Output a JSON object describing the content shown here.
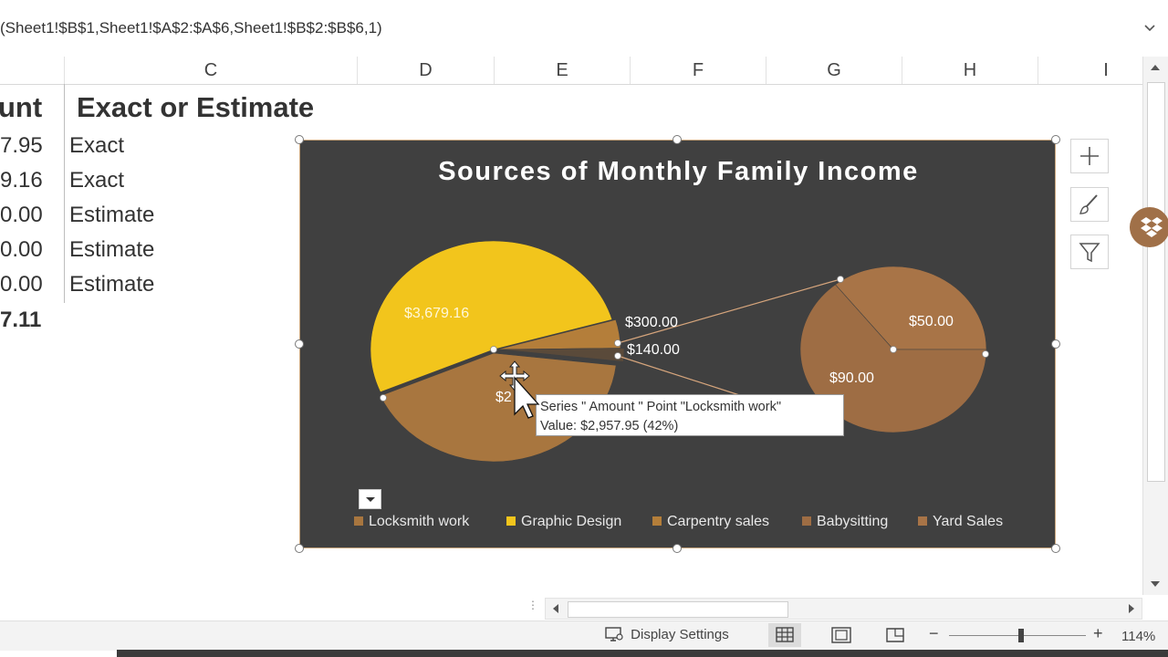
{
  "formula_bar": {
    "text": "(Sheet1!$B$1,Sheet1!$A$2:$A$6,Sheet1!$B$2:$B$6,1)"
  },
  "columns": [
    "C",
    "D",
    "E",
    "F",
    "G",
    "H",
    "I"
  ],
  "sheet": {
    "header_amount_partial": "unt",
    "header_exact": "Exact or Estimate",
    "rows": [
      {
        "amount_partial": "7.95",
        "status": "Exact"
      },
      {
        "amount_partial": "9.16",
        "status": "Exact"
      },
      {
        "amount_partial": "0.00",
        "status": "Estimate"
      },
      {
        "amount_partial": "0.00",
        "status": "Estimate"
      },
      {
        "amount_partial": "0.00",
        "status": "Estimate"
      }
    ],
    "total_partial": "7.11"
  },
  "chart_data": {
    "type": "pie",
    "subtype": "pie-of-pie",
    "title": "Sources of Monthly Family Income",
    "categories": [
      "Locksmith work",
      "Graphic Design",
      "Carpentry sales",
      "Babysitting",
      "Yard Sales"
    ],
    "series": [
      {
        "name": "Amount",
        "values": [
          2957.95,
          3679.16,
          300.0,
          90.0,
          50.0
        ]
      }
    ],
    "data_labels": {
      "graphic_design": "$3,679.16",
      "locksmith_partial": "$2",
      "other_300": "$300.00",
      "other_140": "$140.00",
      "sub_50": "$50.00",
      "sub_90": "$90.00"
    },
    "legend_position": "bottom",
    "colors": {
      "background": "#404040",
      "locksmith": "#a8763f",
      "graphic_design": "#f2c51c",
      "carpentry": "#b47e3a",
      "babysitting": "#9e6d44",
      "yard_sales": "#a87447",
      "lines": "#d6a57c"
    }
  },
  "tooltip": {
    "line1": "Series \" Amount \" Point \"Locksmith work\"",
    "line2": "Value:  $2,957.95  (42%)"
  },
  "statusbar": {
    "display_settings": "Display Settings",
    "zoom": "114%"
  }
}
